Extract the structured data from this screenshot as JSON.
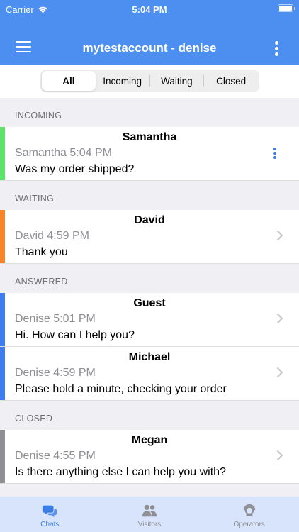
{
  "status": {
    "carrier": "Carrier",
    "time": "5:04 PM"
  },
  "header": {
    "title": "mytestaccount - denise"
  },
  "segments": [
    {
      "label": "All",
      "active": true
    },
    {
      "label": "Incoming",
      "active": false
    },
    {
      "label": "Waiting",
      "active": false
    },
    {
      "label": "Closed",
      "active": false
    }
  ],
  "sections": [
    {
      "title": "INCOMING",
      "color": "#5ee26a",
      "rows": [
        {
          "name": "Samantha",
          "meta": "Samantha 5:04 PM",
          "message": "Was my order shipped?",
          "action": "more-icon"
        }
      ]
    },
    {
      "title": "WAITING",
      "color": "#f5862a",
      "rows": [
        {
          "name": "David",
          "meta": "David 4:59 PM",
          "message": "Thank you",
          "action": "chevron-right-icon"
        }
      ]
    },
    {
      "title": "ANSWERED",
      "color": "#3d7ff2",
      "rows": [
        {
          "name": "Guest",
          "meta": "Denise 5:01 PM",
          "message": "Hi. How can I help you?",
          "action": "chevron-right-icon"
        },
        {
          "name": "Michael",
          "meta": "Denise 4:59 PM",
          "message": "Please hold a minute, checking your order",
          "action": "chevron-right-icon"
        }
      ]
    },
    {
      "title": "CLOSED",
      "color": "#8e8e93",
      "rows": [
        {
          "name": "Megan",
          "meta": "Denise 4:55 PM",
          "message": "Is there anything else I can help you with?",
          "action": "chevron-right-icon"
        }
      ]
    }
  ],
  "tabs": [
    {
      "label": "Chats",
      "icon": "chats-icon",
      "active": true
    },
    {
      "label": "Visitors",
      "icon": "visitors-icon",
      "active": false
    },
    {
      "label": "Operators",
      "icon": "operators-icon",
      "active": false
    }
  ],
  "colors": {
    "accent": "#4c8ff0",
    "tab_active": "#3b7de6",
    "tab_inactive": "#8e8e93",
    "tabbar_bg": "#d7e4fb"
  }
}
